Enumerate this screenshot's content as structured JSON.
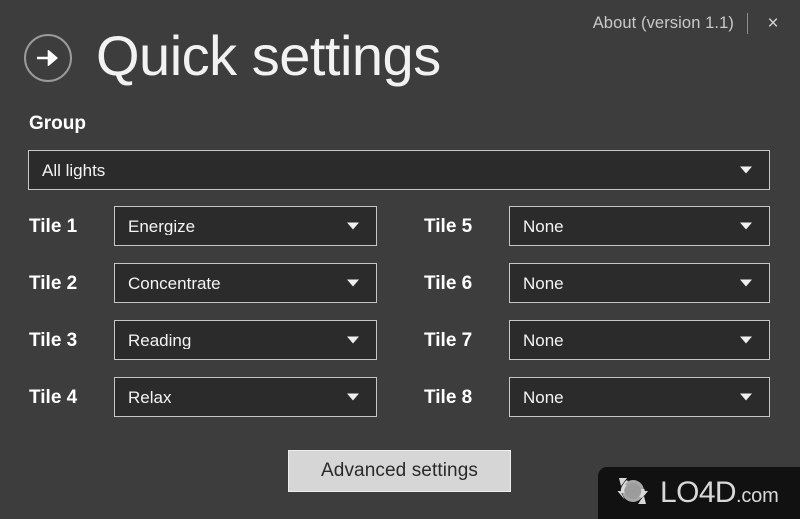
{
  "window": {
    "background_color": "#3d3d3d",
    "title": "Quick settings"
  },
  "topbar": {
    "about_label": "About (version 1.1)",
    "close_label": "×",
    "separator": "|"
  },
  "header": {
    "back_icon": "arrow-right-circle-icon",
    "title": "Quick settings"
  },
  "group": {
    "label": "Group",
    "value": "All lights",
    "caret": "chevron-down-icon"
  },
  "tiles": {
    "left": [
      {
        "label": "Tile 1",
        "value": "Energize"
      },
      {
        "label": "Tile 2",
        "value": "Concentrate"
      },
      {
        "label": "Tile 3",
        "value": "Reading"
      },
      {
        "label": "Tile 4",
        "value": "Relax"
      }
    ],
    "right": [
      {
        "label": "Tile 5",
        "value": "None"
      },
      {
        "label": "Tile 6",
        "value": "None"
      },
      {
        "label": "Tile 7",
        "value": "None"
      },
      {
        "label": "Tile 8",
        "value": "None"
      }
    ]
  },
  "buttons": {
    "advanced_settings": "Advanced settings"
  },
  "watermark": {
    "name": "LO4D",
    "suffix": ".com",
    "logo_icon": "circular-arrows-logo-icon",
    "background_color": "#111111"
  },
  "colors": {
    "background": "#3d3d3d",
    "field_fill": "#2b2b2b",
    "field_border": "#c6c6c6",
    "text_primary": "#ffffff",
    "text_muted": "#c9c9c9",
    "button_fill": "#d6d6d6"
  }
}
